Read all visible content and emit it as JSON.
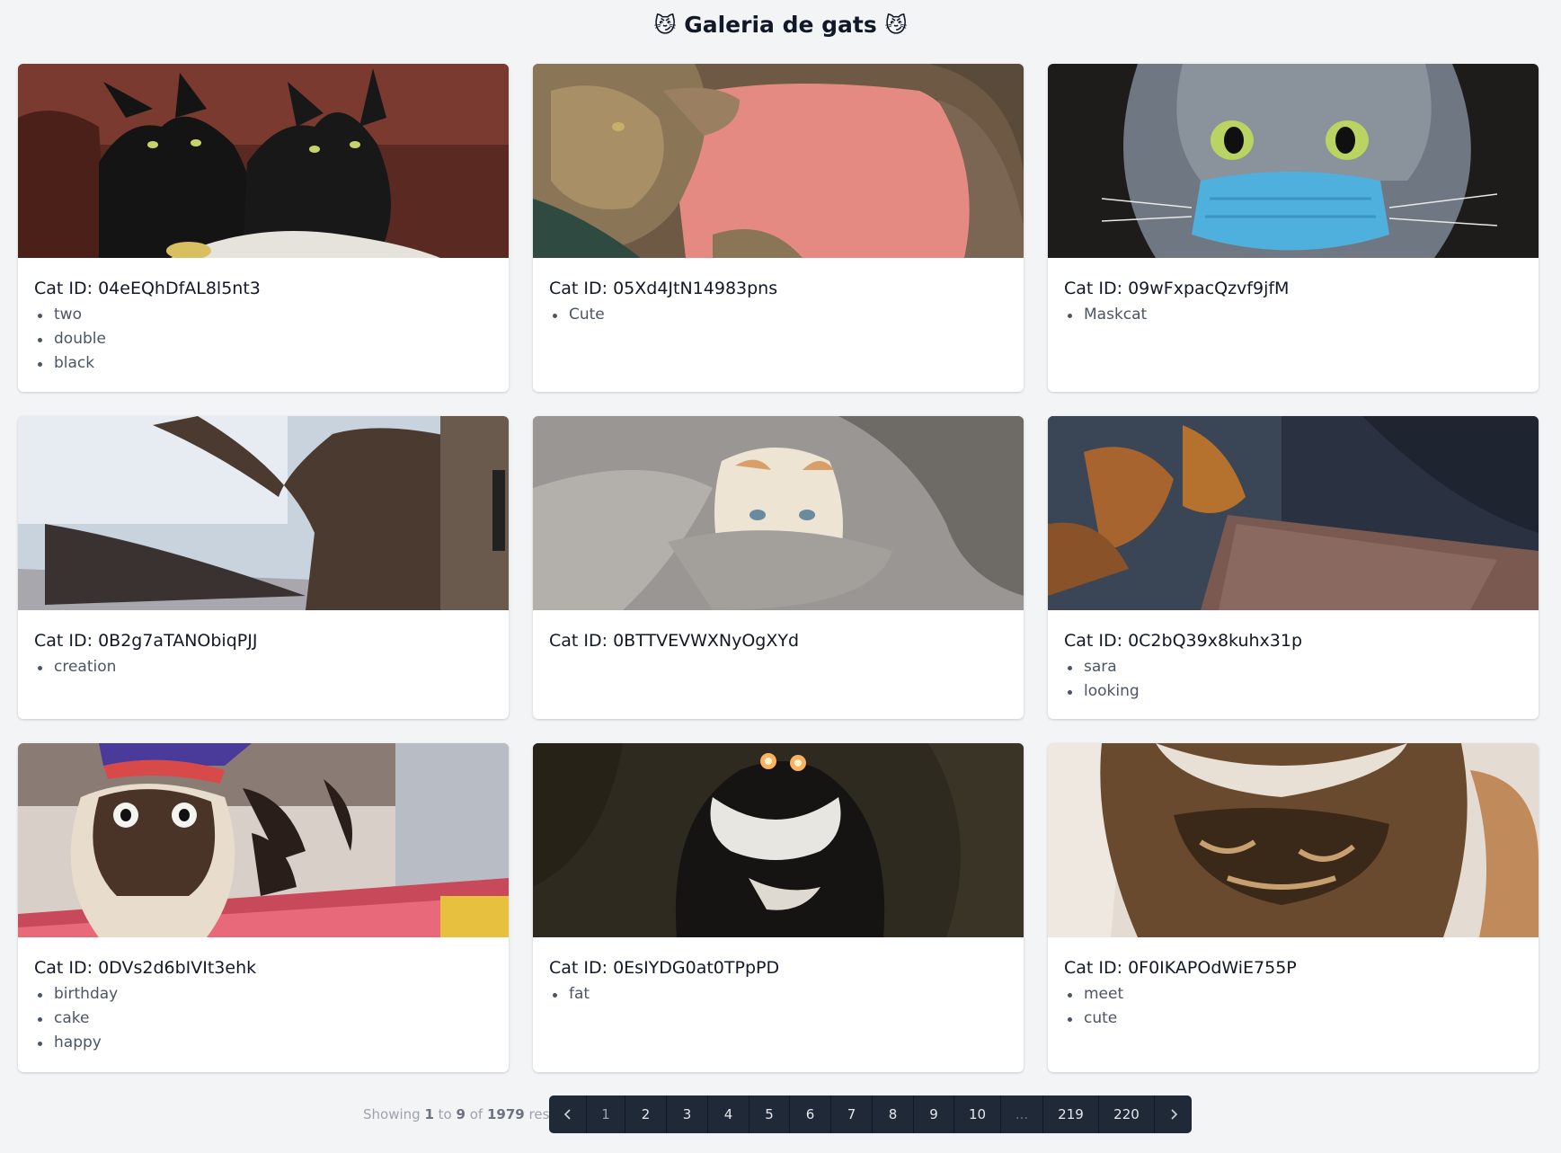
{
  "title": {
    "emoji": "😼",
    "text": "Galeria de gats"
  },
  "cards": [
    {
      "id_label": "Cat ID: 04eEQhDfAL8l5nt3",
      "tags": [
        "two",
        "double",
        "black"
      ]
    },
    {
      "id_label": "Cat ID: 05Xd4JtN14983pns",
      "tags": [
        "Cute"
      ]
    },
    {
      "id_label": "Cat ID: 09wFxpacQzvf9jfM",
      "tags": [
        "Maskcat"
      ]
    },
    {
      "id_label": "Cat ID: 0B2g7aTANObiqPJJ",
      "tags": [
        "creation"
      ]
    },
    {
      "id_label": "Cat ID: 0BTTVEVWXNyOgXYd",
      "tags": []
    },
    {
      "id_label": "Cat ID: 0C2bQ39x8kuhx31p",
      "tags": [
        "sara",
        "looking"
      ]
    },
    {
      "id_label": "Cat ID: 0DVs2d6bIVIt3ehk",
      "tags": [
        "birthday",
        "cake",
        "happy"
      ]
    },
    {
      "id_label": "Cat ID: 0EsIYDG0at0TPpPD",
      "tags": [
        "fat"
      ]
    },
    {
      "id_label": "Cat ID: 0F0IKAPOdWiE755P",
      "tags": [
        "meet",
        "cute"
      ]
    }
  ],
  "pagination": {
    "info_prefix": "Showing",
    "from": "1",
    "info_to": "to",
    "to": "9",
    "info_of": "of",
    "total": "1979",
    "info_suffix": "results",
    "prev_icon": "chevron-left-icon",
    "next_icon": "chevron-right-icon",
    "pages": [
      "1",
      "2",
      "3",
      "4",
      "5",
      "6",
      "7",
      "8",
      "9",
      "10",
      "...",
      "219",
      "220"
    ],
    "current_page": "1"
  }
}
